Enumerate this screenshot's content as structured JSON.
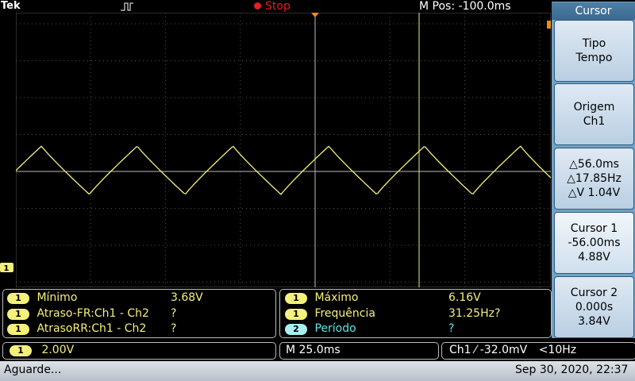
{
  "top_bar": {
    "brand": "Tek",
    "acq_state": "Stop",
    "horizontal_position": "M Pos: -100.0ms"
  },
  "colors": {
    "ch1": "#f5f07a",
    "ch2": "#5fe6e6",
    "cursor": "#f5f07a",
    "stop": "#e02020"
  },
  "side_menu": {
    "title": "Cursor",
    "buttons": [
      {
        "line1": "Tipo",
        "line2": "Tempo"
      },
      {
        "line1": "Origem",
        "line2": "Ch1"
      },
      {
        "line1": "△56.0ms",
        "line2": "△17.85Hz",
        "line3": "△V 1.04V"
      },
      {
        "line1": "Cursor 1",
        "line2": "-56.00ms",
        "line3": "4.88V"
      },
      {
        "line1": "Cursor 2",
        "line2": "0.000s",
        "line3": "3.84V"
      }
    ]
  },
  "measurements": {
    "left": [
      {
        "ch": "1",
        "name": "Mínimo",
        "value": "3.68V"
      },
      {
        "ch": "1",
        "name": "Atraso-FR:Ch1 - Ch2",
        "value": "?"
      },
      {
        "ch": "1",
        "name": "AtrasoRR:Ch1 - Ch2",
        "value": "?"
      }
    ],
    "right": [
      {
        "ch": "1",
        "name": "Máximo",
        "value": "6.16V"
      },
      {
        "ch": "1",
        "name": "Frequência",
        "value": "31.25Hz?"
      },
      {
        "ch": "2",
        "name": "Período",
        "value": "?"
      }
    ]
  },
  "readout": {
    "ch1_scale_badge": "1",
    "ch1_scale": "2.00V",
    "timebase": "M 25.0ms",
    "trigger": "Ch1 ⁄ -32.0mV",
    "trigger_filter": "<10Hz"
  },
  "status": {
    "message": "Aguarde...",
    "datetime": "Sep 30, 2020, 22:37"
  },
  "ch1_marker": "1",
  "waveform": {
    "type": "triangle",
    "frequency_hz": 31.25,
    "min_v": 3.68,
    "max_v": 6.16,
    "cursor_time_ms": 0.0
  }
}
